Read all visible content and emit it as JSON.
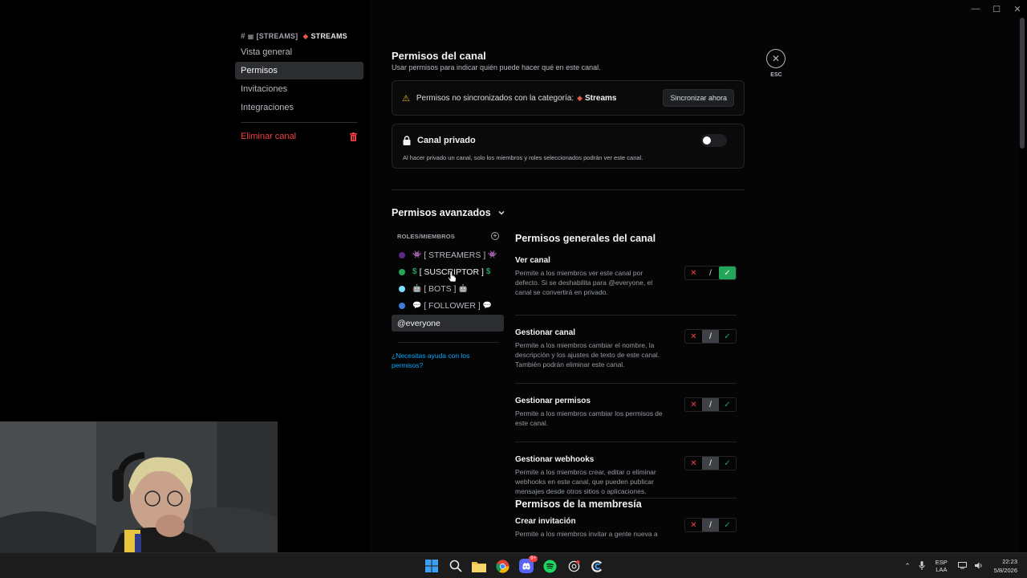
{
  "window": {
    "minimize": "—",
    "maximize": "☐",
    "close": "✕"
  },
  "sidebar": {
    "header": {
      "hash": "#",
      "part1": "[STREAMS]",
      "part2": "STREAMS"
    },
    "items": [
      {
        "label": "Vista general"
      },
      {
        "label": "Permisos"
      },
      {
        "label": "Invitaciones"
      },
      {
        "label": "Integraciones"
      }
    ],
    "delete_label": "Eliminar canal"
  },
  "page": {
    "title": "Permisos del canal",
    "subtitle": "Usar permisos para indicar quién puede hacer qué en este canal."
  },
  "sync": {
    "text": "Permisos no sincronizados con la categoría:",
    "category": "Streams",
    "button": "Sincronizar ahora"
  },
  "private": {
    "title": "Canal privado",
    "description": "Al hacer privado un canal, solo los miembros y roles seleccionados podrán ver este canal.",
    "enabled": false
  },
  "advanced": {
    "title": "Permisos avanzados",
    "roles_header": "ROLES/MIEMBROS",
    "roles": [
      {
        "label": "[ STREAMERS ]",
        "color": "#5b2a86",
        "emoji": "👾"
      },
      {
        "label": "[ SUSCRIPTOR ]",
        "color": "#23a55a",
        "emoji": "💲"
      },
      {
        "label": "[ BOTS ]",
        "color": "#7fe0f5",
        "emoji": "🤖"
      },
      {
        "label": "[ FOLLOWER ]",
        "color": "#3b7dd8",
        "emoji": "💬"
      }
    ],
    "everyone": "@everyone",
    "help": "¿Necesitas ayuda con los permisos?"
  },
  "sections": [
    {
      "title": "Permisos generales del canal",
      "perms": [
        {
          "name": "Ver canal",
          "desc": "Permite a los miembros ver este canal por defecto. Si se deshabilita para @everyone, el canal se convertirá en privado.",
          "state": "allow"
        },
        {
          "name": "Gestionar canal",
          "desc": "Permite a los miembros cambiar el nombre, la descripción y los ajustes de texto de este canal. También podrán eliminar este canal.",
          "state": "pass"
        },
        {
          "name": "Gestionar permisos",
          "desc": "Permite a los miembros cambiar los permisos de este canal.",
          "state": "pass"
        },
        {
          "name": "Gestionar webhooks",
          "desc": "Permite a los miembros crear, editar o eliminar webhooks en este canal, que pueden publicar mensajes desde otros sitios o aplicaciones.",
          "state": "pass"
        }
      ]
    },
    {
      "title": "Permisos de la membresía",
      "perms": [
        {
          "name": "Crear invitación",
          "desc": "Permite a los miembros invitar a gente nueva a",
          "state": "pass"
        }
      ]
    }
  ],
  "tri": {
    "deny": "✕",
    "pass": "/",
    "allow": "✓"
  },
  "close": {
    "icon": "✕",
    "label": "ESC"
  },
  "taskbar": {
    "apps": [
      "start-icon",
      "search-icon",
      "file-explorer-icon",
      "chrome-icon",
      "discord-icon",
      "spotify-icon",
      "openai-icon",
      "ccleaner-icon"
    ],
    "discord_badge": "9+",
    "lang_top": "ESP",
    "lang_bottom": "LAA",
    "time": "22:23",
    "date": "5/8/2026"
  }
}
